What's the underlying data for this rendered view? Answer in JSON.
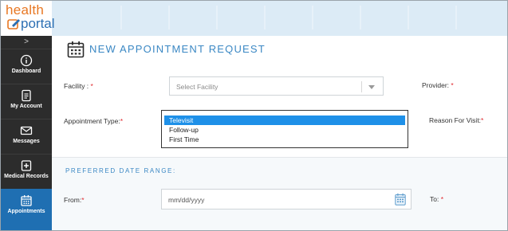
{
  "app": {
    "logo_word1": "health",
    "logo_word2": "portal",
    "brand_orange": "#e87722",
    "brand_blue": "#2c6fb3"
  },
  "sidebar": {
    "collapse_icon": "chevron-right-icon",
    "active_color": "#1f6fb2",
    "items": [
      {
        "label": "Dashboard",
        "icon": "info-icon"
      },
      {
        "label": "My Account",
        "icon": "document-icon"
      },
      {
        "label": "Messages",
        "icon": "mail-icon"
      },
      {
        "label": "Medical Records",
        "icon": "medical-record-icon"
      },
      {
        "label": "Appointments",
        "icon": "calendar-icon",
        "active": true
      }
    ]
  },
  "page": {
    "title": "NEW APPOINTMENT REQUEST",
    "title_icon": "calendar-icon",
    "accent": "#3b88c4"
  },
  "form": {
    "facility": {
      "label": "Facility : ",
      "required_mark": "*",
      "placeholder": "Select Facility"
    },
    "provider": {
      "label": "Provider: ",
      "required_mark": "*"
    },
    "appointment_type": {
      "label": "Appointment Type:",
      "required_mark": "*",
      "options": [
        "Televisit",
        "Follow-up",
        "First Time"
      ],
      "highlighted": "Televisit"
    },
    "reason": {
      "label": "Reason For Visit:",
      "required_mark": "*"
    }
  },
  "date_range": {
    "title": "PREFERRED DATE RANGE:",
    "from": {
      "label": "From:",
      "required_mark": "*",
      "placeholder": "mm/dd/yyyy"
    },
    "to": {
      "label": "To: ",
      "required_mark": "*"
    }
  }
}
